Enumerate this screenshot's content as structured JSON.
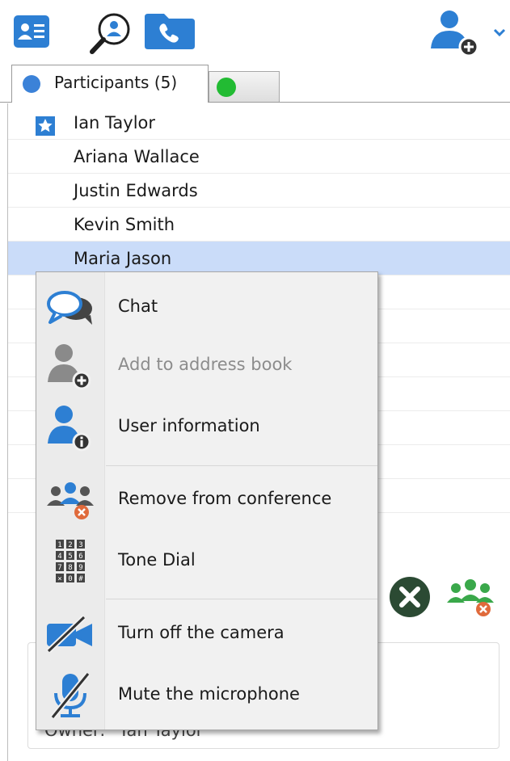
{
  "toolbar": {
    "buttons": [
      {
        "name": "contacts-icon"
      },
      {
        "name": "search-contacts-icon"
      },
      {
        "name": "call-icon"
      }
    ],
    "add_user_icon": "add-user-icon",
    "dropdown_icon": "chevron-down-icon"
  },
  "tabs": [
    {
      "label": "Participants (5)",
      "status_color": "#3b82d8",
      "active": true
    },
    {
      "label": "",
      "status_color": "#22bb33",
      "active": false
    }
  ],
  "participants": [
    {
      "name": "Ian Taylor",
      "owner": true
    },
    {
      "name": "Ariana Wallace"
    },
    {
      "name": "Justin Edwards"
    },
    {
      "name": "Kevin Smith"
    },
    {
      "name": "Maria Jason",
      "selected": true
    }
  ],
  "context_menu": {
    "items": [
      {
        "label": "Chat",
        "icon": "chat-icon",
        "enabled": true
      },
      {
        "label": "Add to address book",
        "icon": "add-contact-icon",
        "enabled": false
      },
      {
        "label": "User information",
        "icon": "user-info-icon",
        "enabled": true
      },
      {
        "label": "Remove from conference",
        "icon": "remove-participant-icon",
        "enabled": true
      },
      {
        "label": "Tone Dial",
        "icon": "dialpad-icon",
        "enabled": true
      },
      {
        "label": "Turn off the camera",
        "icon": "camera-off-icon",
        "enabled": true
      },
      {
        "label": "Mute the microphone",
        "icon": "mic-off-icon",
        "enabled": true
      }
    ]
  },
  "bottom": {
    "owner_text": "Owner:   Ian Taylor"
  },
  "colors": {
    "accent": "#2d7fd3",
    "selection": "#cadcf9",
    "status_green": "#22bb33",
    "danger": "#e06a3b"
  }
}
